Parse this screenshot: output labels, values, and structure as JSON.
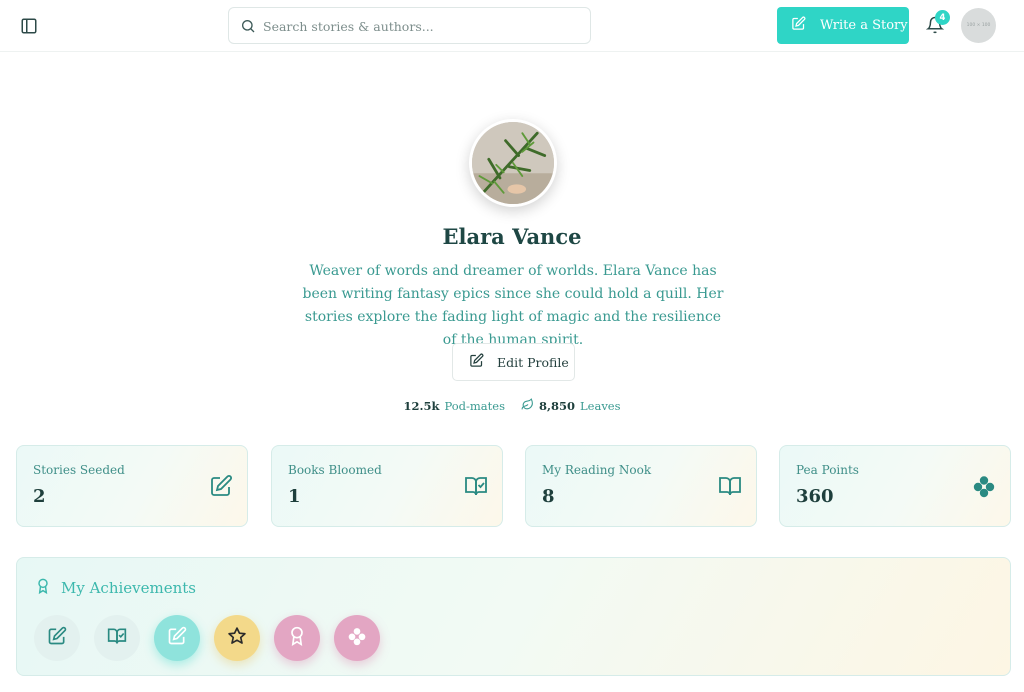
{
  "header": {
    "search_placeholder": "Search stories & authors...",
    "write_label": "Write a Story",
    "notification_count": "4",
    "avatar_placeholder": "100 × 100"
  },
  "profile": {
    "name": "Elara Vance",
    "bio": "Weaver of words and dreamer of worlds. Elara Vance has been writing fantasy epics since she could hold a quill. Her stories explore the fading light of magic and the resilience of the human spirit.",
    "edit_label": "Edit Profile",
    "podmates_value": "12.5k",
    "podmates_label": "Pod-mates",
    "leaves_value": "8,850",
    "leaves_label": "Leaves"
  },
  "stats": [
    {
      "label": "Stories Seeded",
      "value": "2",
      "icon": "edit-square-icon"
    },
    {
      "label": "Books Bloomed",
      "value": "1",
      "icon": "book-check-icon"
    },
    {
      "label": "My Reading Nook",
      "value": "8",
      "icon": "open-book-icon"
    },
    {
      "label": "Pea Points",
      "value": "360",
      "icon": "peas-icon"
    }
  ],
  "achievements": {
    "title": "My Achievements",
    "badges": [
      "edit-square-icon",
      "book-check-icon",
      "edit-square-icon",
      "star-icon",
      "award-icon",
      "peas-icon"
    ]
  },
  "colors": {
    "accent": "#2fd5c6",
    "text_dark": "#1e4744",
    "text_teal": "#3a9a91",
    "gold": "#f3d98a",
    "pink": "#e3a6c3"
  }
}
